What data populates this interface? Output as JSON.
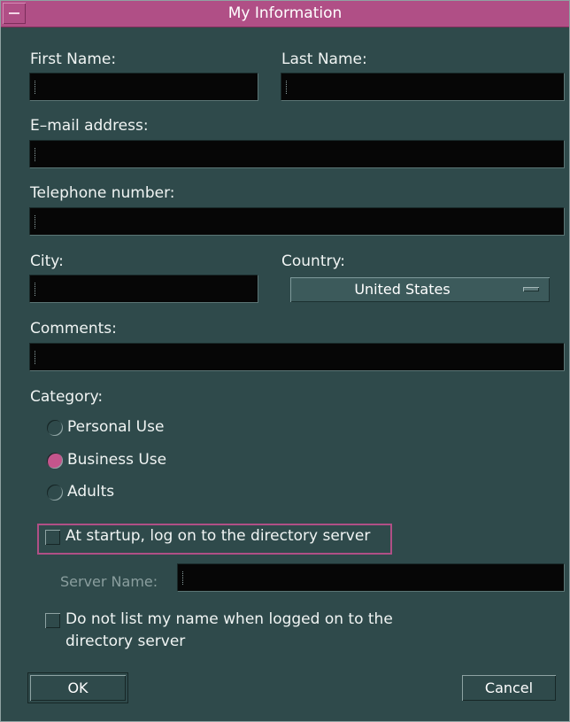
{
  "window": {
    "title": "My Information"
  },
  "form": {
    "first_name": {
      "label": "First Name:",
      "value": ""
    },
    "last_name": {
      "label": "Last Name:",
      "value": ""
    },
    "email": {
      "label": "E–mail address:",
      "value": ""
    },
    "telephone": {
      "label": "Telephone number:",
      "value": ""
    },
    "city": {
      "label": "City:",
      "value": ""
    },
    "country": {
      "label": "Country:",
      "selected": "United States"
    },
    "comments": {
      "label": "Comments:",
      "value": ""
    }
  },
  "category": {
    "label": "Category:",
    "options": [
      {
        "label": "Personal Use",
        "selected": false
      },
      {
        "label": "Business Use",
        "selected": true
      },
      {
        "label": "Adults",
        "selected": false
      }
    ]
  },
  "startup_checkbox": {
    "label": "At startup, log on to the directory server",
    "checked": false
  },
  "server_name": {
    "label": "Server Name:",
    "value": ""
  },
  "unlisted_checkbox": {
    "line1": "Do not list my name when logged on to the",
    "line2": "directory server",
    "checked": false
  },
  "buttons": {
    "ok": "OK",
    "cancel": "Cancel"
  },
  "colors": {
    "title_accent": "#b04f86",
    "background": "#2f4a4b",
    "field_bg": "#060606"
  }
}
